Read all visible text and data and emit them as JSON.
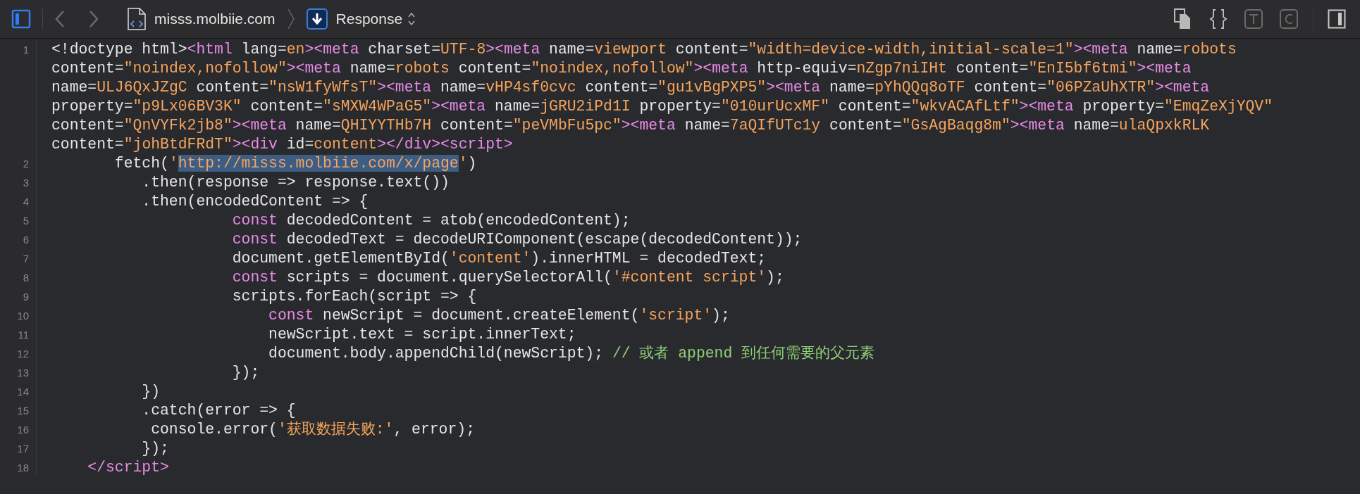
{
  "toolbar": {
    "left_sidebar": {
      "on": true
    },
    "breadcrumb": {
      "site": "misss.molbiie.com",
      "resource": "Response"
    },
    "tools": [
      {
        "kind": "copy",
        "disabled": false
      },
      {
        "kind": "braces",
        "disabled": false
      },
      {
        "kind": "letter-t",
        "disabled": true
      },
      {
        "kind": "letter-c",
        "disabled": true
      }
    ],
    "right_sidebar": {
      "on": false
    }
  },
  "code": {
    "lines": [
      {
        "number": "1",
        "rows": [
          {
            "segments": [
              {
                "kind": "plain",
                "text": "<!doctype html>"
              },
              {
                "kind": "tag",
                "text": "<html"
              },
              {
                "kind": "plain",
                "text": " lang="
              },
              {
                "kind": "value",
                "text": "en"
              },
              {
                "kind": "tag",
                "text": "><meta"
              },
              {
                "kind": "plain",
                "text": " charset="
              },
              {
                "kind": "value",
                "text": "UTF-8"
              },
              {
                "kind": "tag",
                "text": "><meta"
              },
              {
                "kind": "plain",
                "text": " name="
              },
              {
                "kind": "value",
                "text": "viewport"
              },
              {
                "kind": "plain",
                "text": " content="
              },
              {
                "kind": "value",
                "text": "\"width=device-width,initial-scale=1\""
              },
              {
                "kind": "tag",
                "text": "><meta"
              },
              {
                "kind": "plain",
                "text": " name="
              },
              {
                "kind": "value",
                "text": "robots"
              }
            ]
          },
          {
            "segments": [
              {
                "kind": "plain",
                "text": "content="
              },
              {
                "kind": "value",
                "text": "\"noindex,nofollow\""
              },
              {
                "kind": "tag",
                "text": "><meta"
              },
              {
                "kind": "plain",
                "text": " name="
              },
              {
                "kind": "value",
                "text": "robots"
              },
              {
                "kind": "plain",
                "text": " content="
              },
              {
                "kind": "value",
                "text": "\"noindex,nofollow\""
              },
              {
                "kind": "tag",
                "text": "><meta"
              },
              {
                "kind": "plain",
                "text": " http-equiv="
              },
              {
                "kind": "value",
                "text": "nZgp7niIHt"
              },
              {
                "kind": "plain",
                "text": " content="
              },
              {
                "kind": "value",
                "text": "\"EnI5bf6tmi\""
              },
              {
                "kind": "tag",
                "text": "><meta"
              }
            ]
          },
          {
            "segments": [
              {
                "kind": "plain",
                "text": "name="
              },
              {
                "kind": "value",
                "text": "ULJ6QxJZgC"
              },
              {
                "kind": "plain",
                "text": " content="
              },
              {
                "kind": "value",
                "text": "\"nsW1fyWfsT\""
              },
              {
                "kind": "tag",
                "text": "><meta"
              },
              {
                "kind": "plain",
                "text": " name="
              },
              {
                "kind": "value",
                "text": "vHP4sf0cvc"
              },
              {
                "kind": "plain",
                "text": " content="
              },
              {
                "kind": "value",
                "text": "\"gu1vBgPXP5\""
              },
              {
                "kind": "tag",
                "text": "><meta"
              },
              {
                "kind": "plain",
                "text": " name="
              },
              {
                "kind": "value",
                "text": "pYhQQq8oTF"
              },
              {
                "kind": "plain",
                "text": " content="
              },
              {
                "kind": "value",
                "text": "\"06PZaUhXTR\""
              },
              {
                "kind": "tag",
                "text": "><meta"
              }
            ]
          },
          {
            "segments": [
              {
                "kind": "plain",
                "text": "property="
              },
              {
                "kind": "value",
                "text": "\"p9Lx06BV3K\""
              },
              {
                "kind": "plain",
                "text": " content="
              },
              {
                "kind": "value",
                "text": "\"sMXW4WPaG5\""
              },
              {
                "kind": "tag",
                "text": "><meta"
              },
              {
                "kind": "plain",
                "text": " name="
              },
              {
                "kind": "value",
                "text": "jGRU2iPd1I"
              },
              {
                "kind": "plain",
                "text": " property="
              },
              {
                "kind": "value",
                "text": "\"010urUcxMF\""
              },
              {
                "kind": "plain",
                "text": " content="
              },
              {
                "kind": "value",
                "text": "\"wkvACAfLtf\""
              },
              {
                "kind": "tag",
                "text": "><meta"
              },
              {
                "kind": "plain",
                "text": " property="
              },
              {
                "kind": "value",
                "text": "\"EmqZeXjYQV\""
              }
            ]
          },
          {
            "segments": [
              {
                "kind": "plain",
                "text": "content="
              },
              {
                "kind": "value",
                "text": "\"QnVYFk2jb8\""
              },
              {
                "kind": "tag",
                "text": "><meta"
              },
              {
                "kind": "plain",
                "text": " name="
              },
              {
                "kind": "value",
                "text": "QHIYYTHb7H"
              },
              {
                "kind": "plain",
                "text": " content="
              },
              {
                "kind": "value",
                "text": "\"peVMbFu5pc\""
              },
              {
                "kind": "tag",
                "text": "><meta"
              },
              {
                "kind": "plain",
                "text": " name="
              },
              {
                "kind": "value",
                "text": "7aQIfUTc1y"
              },
              {
                "kind": "plain",
                "text": " content="
              },
              {
                "kind": "value",
                "text": "\"GsAgBaqg8m\""
              },
              {
                "kind": "tag",
                "text": "><meta"
              },
              {
                "kind": "plain",
                "text": " name="
              },
              {
                "kind": "value",
                "text": "ulaQpxkRLK"
              }
            ]
          },
          {
            "segments": [
              {
                "kind": "plain",
                "text": "content="
              },
              {
                "kind": "value",
                "text": "\"johBtdFRdT\""
              },
              {
                "kind": "tag",
                "text": "><div"
              },
              {
                "kind": "plain",
                "text": " id="
              },
              {
                "kind": "value",
                "text": "content"
              },
              {
                "kind": "tag",
                "text": "></div><script>"
              }
            ]
          }
        ]
      },
      {
        "number": "2",
        "rows": [
          {
            "segments": [
              {
                "kind": "plain",
                "text": "       fetch("
              },
              {
                "kind": "string",
                "text": "'"
              },
              {
                "kind": "selected-string",
                "text": "http://misss.molbiie.com/x/page"
              },
              {
                "kind": "string",
                "text": "'"
              },
              {
                "kind": "plain",
                "text": ")"
              }
            ]
          }
        ]
      },
      {
        "number": "3",
        "rows": [
          {
            "segments": [
              {
                "kind": "plain",
                "text": "          .then(response => response.text())"
              }
            ]
          }
        ]
      },
      {
        "number": "4",
        "rows": [
          {
            "segments": [
              {
                "kind": "plain",
                "text": "          .then(encodedContent => {"
              }
            ]
          }
        ]
      },
      {
        "number": "5",
        "rows": [
          {
            "segments": [
              {
                "kind": "keyword",
                "text": "                    const"
              },
              {
                "kind": "plain",
                "text": " decodedContent = atob(encodedContent);"
              }
            ]
          }
        ]
      },
      {
        "number": "6",
        "rows": [
          {
            "segments": [
              {
                "kind": "keyword",
                "text": "                    const"
              },
              {
                "kind": "plain",
                "text": " decodedText = decodeURIComponent(escape(decodedContent));"
              }
            ]
          }
        ]
      },
      {
        "number": "7",
        "rows": [
          {
            "segments": [
              {
                "kind": "plain",
                "text": "                    document.getElementById("
              },
              {
                "kind": "string",
                "text": "'content'"
              },
              {
                "kind": "plain",
                "text": ").innerHTML = decodedText;"
              }
            ]
          }
        ]
      },
      {
        "number": "8",
        "rows": [
          {
            "segments": [
              {
                "kind": "keyword",
                "text": "                    const"
              },
              {
                "kind": "plain",
                "text": " scripts = document.querySelectorAll("
              },
              {
                "kind": "string",
                "text": "'#content script'"
              },
              {
                "kind": "plain",
                "text": ");"
              }
            ]
          }
        ]
      },
      {
        "number": "9",
        "rows": [
          {
            "segments": [
              {
                "kind": "plain",
                "text": "                    scripts.forEach(script => {"
              }
            ]
          }
        ]
      },
      {
        "number": "10",
        "rows": [
          {
            "segments": [
              {
                "kind": "keyword",
                "text": "                        const"
              },
              {
                "kind": "plain",
                "text": " newScript = document.createElement("
              },
              {
                "kind": "string",
                "text": "'script'"
              },
              {
                "kind": "plain",
                "text": ");"
              }
            ]
          }
        ]
      },
      {
        "number": "11",
        "rows": [
          {
            "segments": [
              {
                "kind": "plain",
                "text": "                        newScript.text = script.innerText;"
              }
            ]
          }
        ]
      },
      {
        "number": "12",
        "rows": [
          {
            "segments": [
              {
                "kind": "plain",
                "text": "                        document.body.appendChild(newScript); "
              },
              {
                "kind": "comment",
                "text": "// 或者 append 到任何需要的父元素"
              }
            ]
          }
        ]
      },
      {
        "number": "13",
        "rows": [
          {
            "segments": [
              {
                "kind": "plain",
                "text": "                    });"
              }
            ]
          }
        ]
      },
      {
        "number": "14",
        "rows": [
          {
            "segments": [
              {
                "kind": "plain",
                "text": "          })"
              }
            ]
          }
        ]
      },
      {
        "number": "15",
        "rows": [
          {
            "segments": [
              {
                "kind": "plain",
                "text": "          .catch(error => {"
              }
            ]
          }
        ]
      },
      {
        "number": "16",
        "rows": [
          {
            "segments": [
              {
                "kind": "plain",
                "text": "           console.error("
              },
              {
                "kind": "string",
                "text": "'获取数据失败:'"
              },
              {
                "kind": "plain",
                "text": ", error);"
              }
            ]
          }
        ]
      },
      {
        "number": "17",
        "rows": [
          {
            "segments": [
              {
                "kind": "plain",
                "text": "          });"
              }
            ]
          }
        ]
      },
      {
        "number": "18",
        "rows": [
          {
            "segments": [
              {
                "kind": "tag",
                "text": "    </script>"
              }
            ]
          }
        ]
      }
    ]
  }
}
